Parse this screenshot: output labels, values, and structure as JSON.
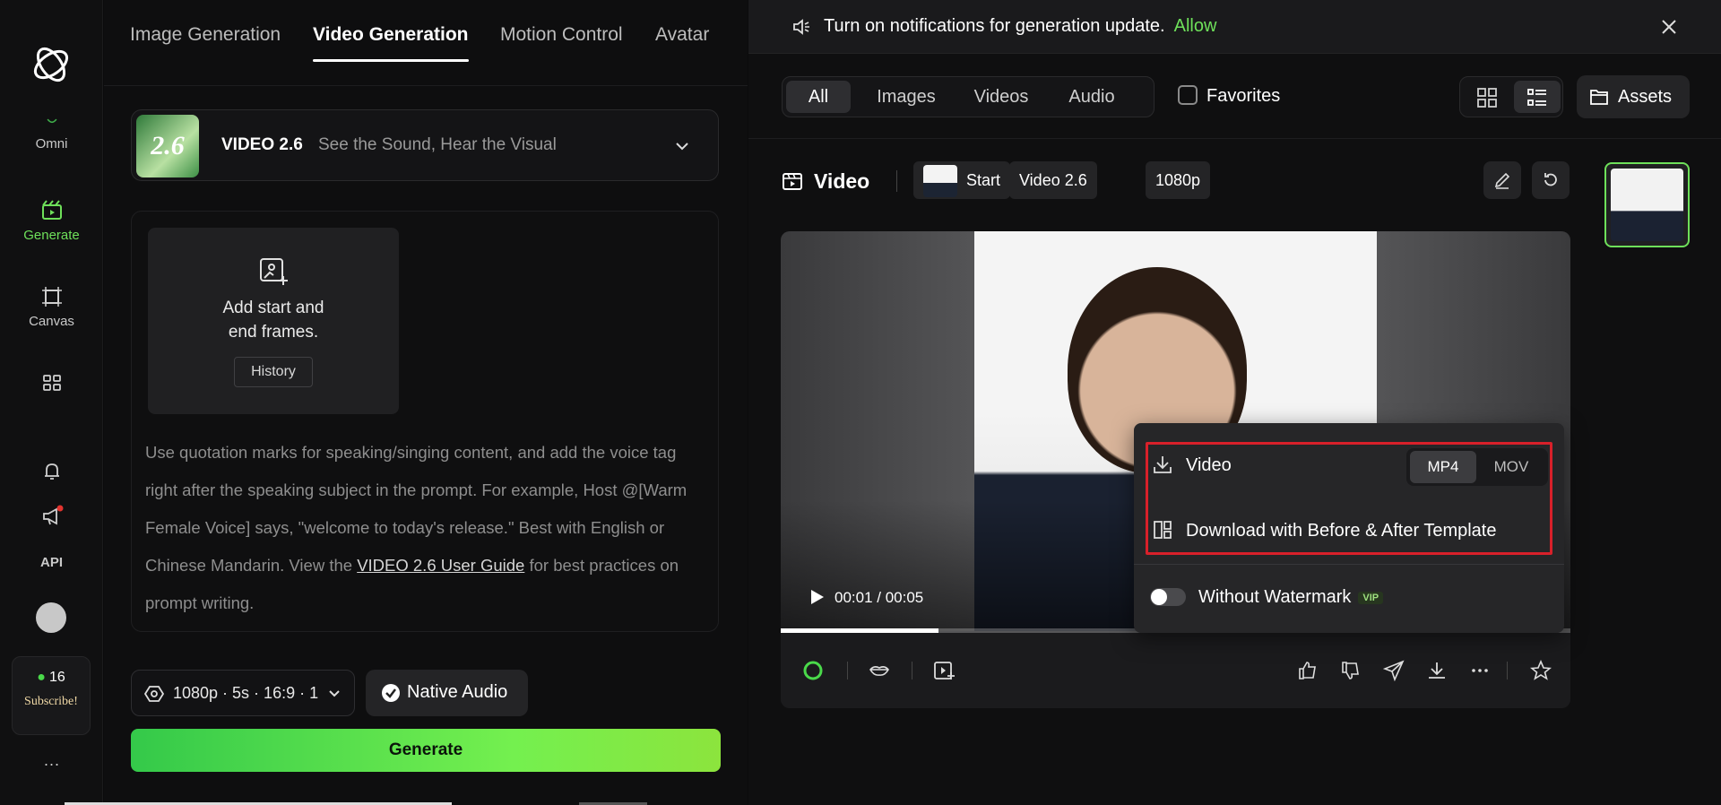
{
  "sidebar": {
    "items": [
      {
        "label": "Omni",
        "icon": "omni-icon"
      },
      {
        "label": "Generate",
        "icon": "generate-icon"
      },
      {
        "label": "Canvas",
        "icon": "canvas-icon"
      },
      {
        "label": "",
        "icon": "apps-grid-icon"
      },
      {
        "label": "",
        "icon": "bell-icon"
      },
      {
        "label": "",
        "icon": "megaphone-icon"
      },
      {
        "label": "API",
        "icon": ""
      }
    ],
    "credits": "16",
    "subscribe": "Subscribe!",
    "more": "···",
    "accent": "#6ee05a"
  },
  "tabs": [
    "Image Generation",
    "Video Generation",
    "Motion Control",
    "Avatar"
  ],
  "model": {
    "thumb_text": "2.6",
    "name": "VIDEO 2.6",
    "tagline": "See the Sound, Hear the Visual"
  },
  "frames": {
    "line1": "Add start and",
    "line2": "end frames.",
    "history": "History"
  },
  "prompt": {
    "part1": "Use quotation marks for speaking/singing content, and add the voice tag right after the speaking subject in the prompt. For example, Host @[Warm Female Voice] says, \"welcome to today's release.\" Best with English or Chinese Mandarin. View the ",
    "link": "VIDEO 2.6 User Guide",
    "part2": " for best practices on prompt writing."
  },
  "settings": {
    "summary": "1080p · 5s · 16:9 · 1",
    "native_audio": "Native Audio",
    "generate": "Generate"
  },
  "notification": {
    "message": "Turn on notifications for generation update.",
    "allow": "Allow"
  },
  "filters": {
    "segments": [
      "All",
      "Images",
      "Videos",
      "Audio"
    ],
    "active": "All",
    "favorites": "Favorites",
    "assets": "Assets"
  },
  "video": {
    "title": "Video",
    "chips": [
      "Start",
      "Video 2.6",
      "1080p"
    ],
    "time": "00:01 / 00:05",
    "progress": 0.2
  },
  "download_menu": {
    "video_label": "Video",
    "formats": [
      "MP4",
      "MOV"
    ],
    "active_format": "MP4",
    "template_label": "Download with Before & After Template",
    "watermark_label": "Without Watermark",
    "vip": "VIP",
    "highlight_color": "#d8202a"
  }
}
